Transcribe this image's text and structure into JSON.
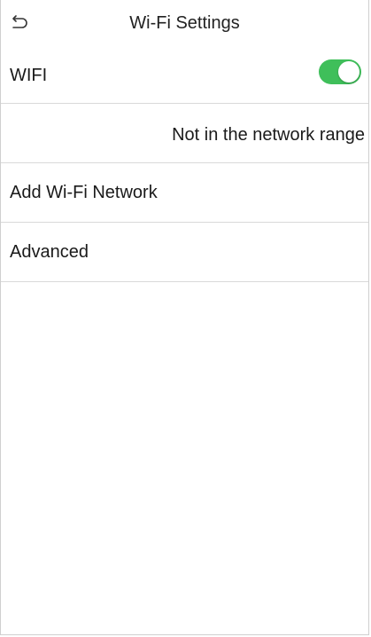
{
  "header": {
    "title": "Wi-Fi Settings",
    "back_icon": "back-arrow-icon"
  },
  "wifi": {
    "label": "WIFI",
    "enabled": true,
    "toggle_color": "#3fbf5a"
  },
  "status": {
    "text": "Not in the network range"
  },
  "menu": {
    "add_network": "Add Wi-Fi Network",
    "advanced": "Advanced"
  }
}
